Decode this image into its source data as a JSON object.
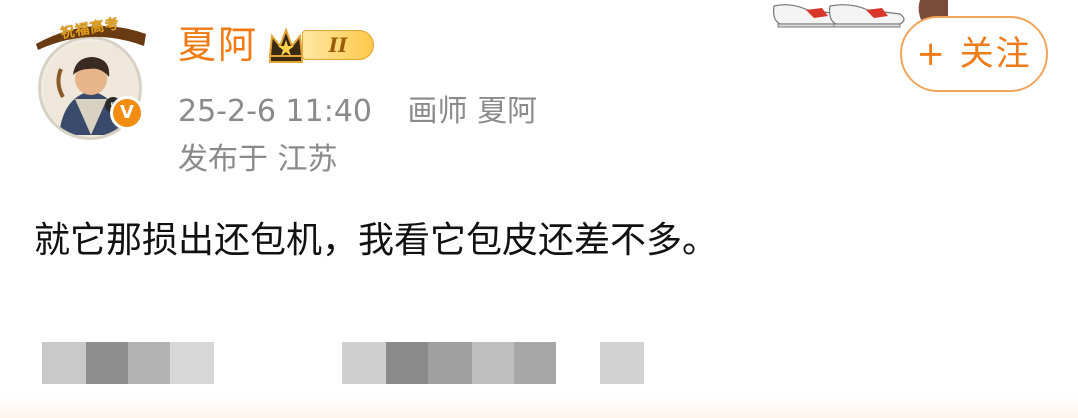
{
  "post": {
    "avatar": {
      "banner_text": "祝福高考",
      "badge_label": "V"
    },
    "author": {
      "name": "夏阿",
      "vip_level": "II"
    },
    "follow_button": "+ 关注",
    "meta": {
      "time": "25-2-6 11:40",
      "source": "画师 夏阿",
      "location": "发布于 江苏"
    },
    "text": "就它那损出还包机，我看它包皮还差不多。"
  },
  "colors": {
    "accent": "#f17a12",
    "meta_text": "#8a8a8a",
    "verified": "#f28d12"
  },
  "icons": [
    "verified-v-icon",
    "crown-icon",
    "sneakers-decoration"
  ]
}
